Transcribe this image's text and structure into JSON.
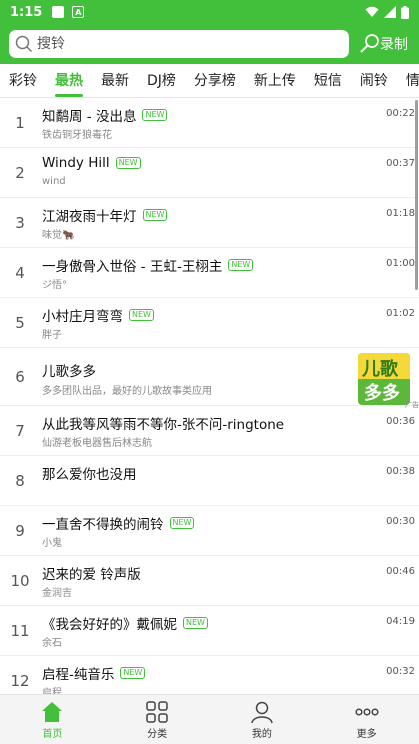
{
  "status_bar": {
    "time": "1:15",
    "a_icon": "A"
  },
  "search": {
    "placeholder": "搜铃",
    "record_label": "录制"
  },
  "tabs": [
    {
      "label": "彩铃"
    },
    {
      "label": "最热"
    },
    {
      "label": "最新"
    },
    {
      "label": "DJ榜"
    },
    {
      "label": "分享榜"
    },
    {
      "label": "新上传"
    },
    {
      "label": "短信"
    },
    {
      "label": "闹铃"
    },
    {
      "label": "情"
    }
  ],
  "new_tag": "NEW",
  "songs": [
    {
      "index": "1",
      "title": "知鹬周 - 没出息",
      "subtitle": "铁齿铜牙狼毒花",
      "duration": "00:22"
    },
    {
      "index": "2",
      "title": "Windy Hill",
      "subtitle": "wind",
      "duration": "00:37"
    },
    {
      "index": "3",
      "title": "江湖夜雨十年灯",
      "subtitle": "味觉🐂",
      "duration": "01:18"
    },
    {
      "index": "4",
      "title": "一身傲骨入世俗 - 王虹-王栩主",
      "subtitle": "ジ悟°",
      "duration": "01:00"
    },
    {
      "index": "5",
      "title": "小村庄月弯弯",
      "subtitle": "胖子",
      "duration": "01:02"
    },
    {
      "index": "6",
      "title": "儿歌多多",
      "subtitle": "多多团队出品，最好的儿歌故事类应用",
      "duration": ""
    },
    {
      "index": "7",
      "title": "从此我等风等雨不等你-张不问-ringtone",
      "subtitle": "仙游老板电器售后林志航",
      "duration": "00:36"
    },
    {
      "index": "8",
      "title": "那么爱你也没用",
      "subtitle": "",
      "duration": "00:38"
    },
    {
      "index": "9",
      "title": "一直舍不得换的闹铃",
      "subtitle": "小鬼",
      "duration": "00:30"
    },
    {
      "index": "10",
      "title": "迟来的爱 铃声版",
      "subtitle": "金润吉",
      "duration": "00:46"
    },
    {
      "index": "11",
      "title": "《我会好好的》戴佩妮",
      "subtitle": "余石",
      "duration": "04:19"
    },
    {
      "index": "12",
      "title": "启程-纯音乐",
      "subtitle": "启程",
      "duration": "00:32"
    }
  ],
  "ad": {
    "line1": "儿歌",
    "line2": "多多",
    "badge": "广告"
  },
  "bottom_nav": [
    {
      "label": "首页"
    },
    {
      "label": "分类"
    },
    {
      "label": "我的"
    },
    {
      "label": "更多"
    }
  ],
  "colors": {
    "brand_green": "#43c03b"
  }
}
